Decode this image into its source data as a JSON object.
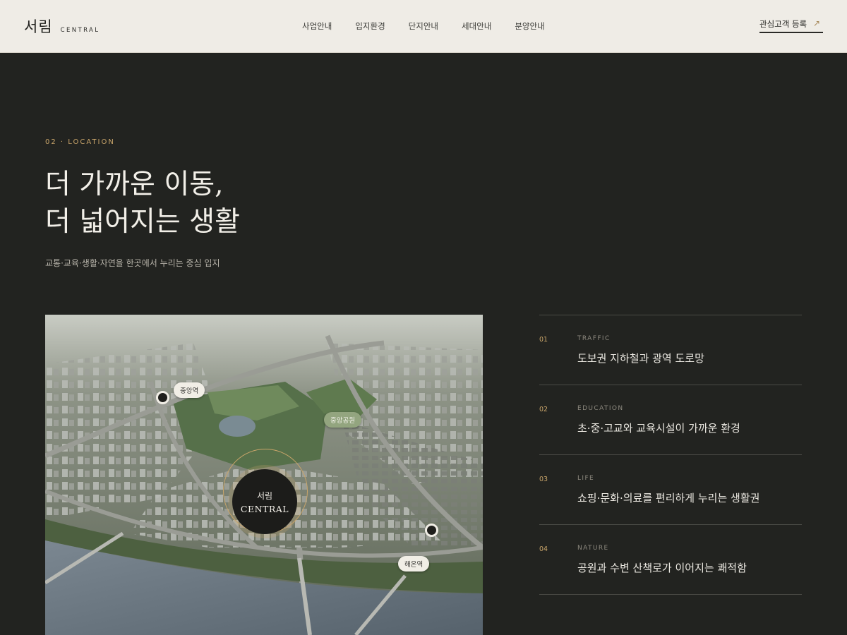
{
  "header": {
    "brand_ko": "서림",
    "brand_en": "CENTRAL",
    "nav": [
      "사업안내",
      "입지환경",
      "단지안내",
      "세대안내",
      "분양안내"
    ],
    "cta_label": "관심고객 등록",
    "cta_icon": "↗"
  },
  "section": {
    "eyebrow": "02 · LOCATION",
    "headline_line1": "더 가까운 이동,",
    "headline_line2": "더 넓어지는 생활",
    "subtitle": "교통·교육·생활·자연을 한곳에서 누리는 중심 입지"
  },
  "map": {
    "pins": {
      "station_1": "중앙역",
      "park": "중앙공원",
      "station_2": "해온역"
    },
    "center_ko": "서림",
    "center_en": "CENTRAL"
  },
  "features": [
    {
      "num": "01",
      "category": "TRAFFIC",
      "title": "도보권 지하철과 광역 도로망"
    },
    {
      "num": "02",
      "category": "EDUCATION",
      "title": "초·중·고교와 교육시설이 가까운 환경"
    },
    {
      "num": "03",
      "category": "LIFE",
      "title": "쇼핑·문화·의료를 편리하게 누리는 생활권"
    },
    {
      "num": "04",
      "category": "NATURE",
      "title": "공원과 수변 산책로가 이어지는 쾌적함"
    }
  ],
  "colors": {
    "accent_gold": "#c9a56a",
    "background": "#222320",
    "header_bg": "#efece6"
  }
}
